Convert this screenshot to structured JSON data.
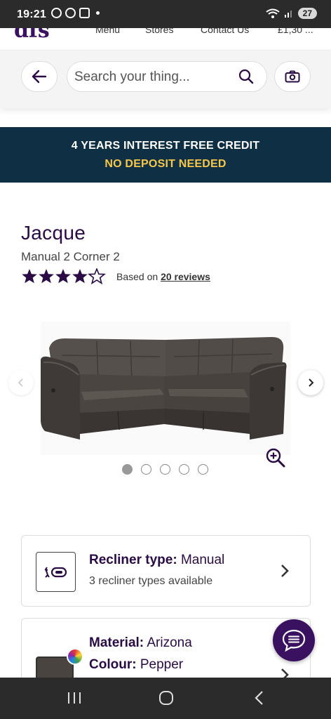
{
  "status_bar": {
    "time": "19:21",
    "battery": "27"
  },
  "topnav": {
    "logo": "dfs",
    "items": [
      "Menu",
      "Stores",
      "Contact Us",
      "£1,30 ..."
    ]
  },
  "search": {
    "placeholder": "Search your thing..."
  },
  "promo": {
    "line1": "4 YEARS INTEREST FREE CREDIT",
    "line2": "NO DEPOSIT NEEDED",
    "line2_color": "#f5c84a",
    "background": "#0f2f44"
  },
  "product": {
    "title": "Jacque",
    "subtitle": "Manual 2 Corner 2",
    "rating_stars": 4.5,
    "reviews_prefix": "Based on",
    "reviews_link": "20 reviews"
  },
  "gallery": {
    "image_count": 5,
    "active_index": 0
  },
  "options": {
    "recliner": {
      "label": "Recliner type:",
      "value": "Manual",
      "sub": "3 recliner types available"
    },
    "material": {
      "label": "Material:",
      "value": "Arizona",
      "colour_label": "Colour:",
      "colour_value": "Pepper"
    }
  },
  "icons": {
    "back": "arrow-left-icon",
    "search": "search-icon",
    "camera": "camera-icon",
    "prev": "chevron-left-icon",
    "next": "chevron-right-icon",
    "zoom": "zoom-in-icon",
    "chat": "chat-icon"
  },
  "colors": {
    "brand": "#2a0b45",
    "chat": "#3a1160"
  }
}
